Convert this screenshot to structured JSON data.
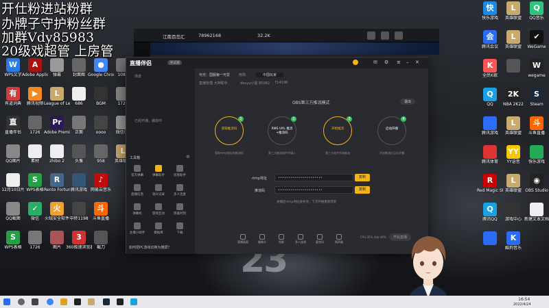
{
  "overlay": [
    "开仕粉进站粉群",
    "办牌子守护粉丝群",
    "加群Vdy85983",
    "20级戏超管 上房管"
  ],
  "desktop_left": [
    {
      "label": "WPS文字",
      "color": "#2a7be4",
      "g": "W"
    },
    {
      "label": "有道词典",
      "color": "#d23b3b",
      "g": "有"
    },
    {
      "label": "直播伴侣",
      "color": "#333",
      "g": "直"
    },
    {
      "label": "QQ图片",
      "color": "#888",
      "g": ""
    },
    {
      "label": "12月10日片",
      "color": "#eee",
      "g": ""
    },
    {
      "label": "QQ截图",
      "color": "#888",
      "g": ""
    },
    {
      "label": "WPS表格",
      "color": "#24a148",
      "g": "S"
    },
    {
      "label": "Adobe Applicati...",
      "color": "#a11",
      "g": "A"
    },
    {
      "label": "腾讯视频",
      "color": "#f08a24",
      "g": "▶"
    },
    {
      "label": "1726",
      "color": "#666",
      "g": ""
    },
    {
      "label": "素材",
      "color": "#eee",
      "g": ""
    },
    {
      "label": "WPS表格",
      "color": "#24a148",
      "g": "S"
    },
    {
      "label": "微信",
      "color": "#2aae67",
      "g": "✓"
    },
    {
      "label": "1726",
      "color": "#777",
      "g": ""
    },
    {
      "label": "弹幕",
      "color": "#999",
      "g": ""
    },
    {
      "label": "League of Legends",
      "color": "#c8aa6e",
      "g": "L"
    },
    {
      "label": "Adobe Premiere...",
      "color": "#2a1a54",
      "g": "Pr"
    },
    {
      "label": "zhibo 2",
      "color": "#eee",
      "g": ""
    },
    {
      "label": "Rento Fortune",
      "color": "#468",
      "g": "R"
    },
    {
      "label": "火绒安全软件",
      "color": "#f0a030",
      "g": "火"
    },
    {
      "label": "图片",
      "color": "#a55",
      "g": ""
    },
    {
      "label": "封面图",
      "color": "#666",
      "g": ""
    },
    {
      "label": "686",
      "color": "#eee",
      "g": ""
    },
    {
      "label": "正面",
      "color": "#777",
      "g": ""
    },
    {
      "label": "头像",
      "color": "#555",
      "g": ""
    },
    {
      "label": "腾讯游戏",
      "color": "#357",
      "g": ""
    },
    {
      "label": "中转1198",
      "color": "#444",
      "g": ""
    },
    {
      "label": "360极速浏览器",
      "color": "#c33",
      "g": "3"
    },
    {
      "label": "Google Chrome",
      "color": "#4285f4",
      "g": "●"
    },
    {
      "label": "BGM",
      "color": "#333",
      "g": ""
    },
    {
      "label": "oooo",
      "color": "#444",
      "g": ""
    },
    {
      "label": "958",
      "color": "#666",
      "g": ""
    },
    {
      "label": "网易云音乐",
      "color": "#c20c0c",
      "g": "♪"
    },
    {
      "label": "斗鱼直播",
      "color": "#f60",
      "g": "斗"
    },
    {
      "label": "截刀",
      "color": "#555",
      "g": ""
    },
    {
      "label": "1080",
      "color": "#777",
      "g": ""
    },
    {
      "label": "1726",
      "color": "#888",
      "g": ""
    },
    {
      "label": "微信(1)",
      "color": "#999",
      "g": ""
    },
    {
      "label": "英雄联盟",
      "color": "#c8aa6e",
      "g": "L"
    }
  ],
  "desktop_right": [
    {
      "label": "快乐游戏",
      "color": "#1e88e5",
      "g": "快"
    },
    {
      "label": "英雄联盟",
      "color": "#c8aa6e",
      "g": "L"
    },
    {
      "label": "QQ音乐",
      "color": "#31c27c",
      "g": "Q"
    },
    {
      "label": "腾讯会议",
      "color": "#2b6cf6",
      "g": "会"
    },
    {
      "label": "英雄联盟",
      "color": "#c8aa6e",
      "g": "L"
    },
    {
      "label": "WeGame",
      "color": "#111",
      "g": "✔"
    },
    {
      "label": "全民K歌",
      "color": "#f55",
      "g": "K"
    },
    {
      "label": "",
      "color": "#555",
      "g": ""
    },
    {
      "label": "wegame",
      "color": "#222",
      "g": "W"
    },
    {
      "label": "QQ",
      "color": "#1aa1e4",
      "g": "Q"
    },
    {
      "label": "NBA 2K22",
      "color": "#222",
      "g": "2K"
    },
    {
      "label": "Steam",
      "color": "#1b2838",
      "g": "S"
    },
    {
      "label": "腾讯游戏",
      "color": "#2b6cf6",
      "g": ""
    },
    {
      "label": "英雄联盟",
      "color": "#c8aa6e",
      "g": "L"
    },
    {
      "label": "斗鱼直播",
      "color": "#f60",
      "g": "斗"
    },
    {
      "label": "腾讯体育",
      "color": "#d33",
      "g": ""
    },
    {
      "label": "YY语音",
      "color": "#f7c600",
      "g": "YY"
    },
    {
      "label": "快乐游戏",
      "color": "#2a5",
      "g": ""
    },
    {
      "label": "Red Magic Studio",
      "color": "#c00",
      "g": "R"
    },
    {
      "label": "英雄联盟",
      "color": "#c8aa6e",
      "g": "L"
    },
    {
      "label": "OBS Studio",
      "color": "#222",
      "g": "◉"
    },
    {
      "label": "腾讯QQ",
      "color": "#1aa1e4",
      "g": "Q"
    },
    {
      "label": "游戏中心",
      "color": "#333",
      "g": ""
    },
    {
      "label": "新建文本文档",
      "color": "#eee",
      "g": ""
    },
    {
      "label": "",
      "color": "#2b6cf6",
      "g": ""
    },
    {
      "label": "酷狗音乐",
      "color": "#2b6cf6",
      "g": "K"
    }
  ],
  "emulator": {
    "title": "江南百岛汇",
    "id": "78962168",
    "gold": "32.2K"
  },
  "app": {
    "logo": "直播伴侣",
    "badge": "测试版",
    "sidebar_hint": "已经开播，播放中",
    "tools_label": "工具箱",
    "tools": [
      {
        "label": "官方弹幕"
      },
      {
        "label": "弹幕助手"
      },
      {
        "label": "房管助手"
      },
      {
        "label": "直播信息"
      },
      {
        "label": "观众记录"
      },
      {
        "label": "多人连麦"
      },
      {
        "label": "弹幕机"
      },
      {
        "label": "游戏互动"
      },
      {
        "label": "惊喜时刻"
      },
      {
        "label": "主播小助手"
      },
      {
        "label": "模板库"
      },
      {
        "label": "下载"
      }
    ],
    "footer_tip": "如何把PC游戏切换为横屏？",
    "header": {
      "category_label": "电竞：",
      "category": "国服第一可爱",
      "tag": "修改",
      "room_title": "中国玩家",
      "room_info": "直播管理  大神助手",
      "uid": "douyu小屋 85982",
      "fans": "714108"
    },
    "obs_title": "OBS第三方推流模式",
    "exit_btn": "退出",
    "steps": [
      {
        "num": "1",
        "label": "获取推流码",
        "desc": "获取rtmp地址和推流码"
      },
      {
        "num": "2",
        "label": "RMS URL 推流+推流码",
        "desc": "第三方推流软件中填入"
      },
      {
        "num": "3",
        "label": "开始推流",
        "desc": "第三方软件开始推流"
      },
      {
        "num": "4",
        "label": "启动开播",
        "desc": "开启推流后点击开播"
      }
    ],
    "rtmp_label": "rtmp地址",
    "rtmp_value": "••••••••••••••••••••••",
    "key_label": "推流码",
    "key_value": "••••••••••••••••••••••",
    "copy_label": "复制",
    "hint": "关播后rtmp地址会失效，下次开播重新获取",
    "bottom_tools": [
      {
        "label": "直播画面"
      },
      {
        "label": "摄像头"
      },
      {
        "label": "投屏"
      },
      {
        "label": "多人连线"
      },
      {
        "label": "麦克风"
      },
      {
        "label": "扬声器"
      }
    ],
    "stats": "CPU:35%  内存:46%",
    "start_btn": "开始直播"
  },
  "taskbar": {
    "time": "16:54",
    "date": "2022/4/24"
  }
}
